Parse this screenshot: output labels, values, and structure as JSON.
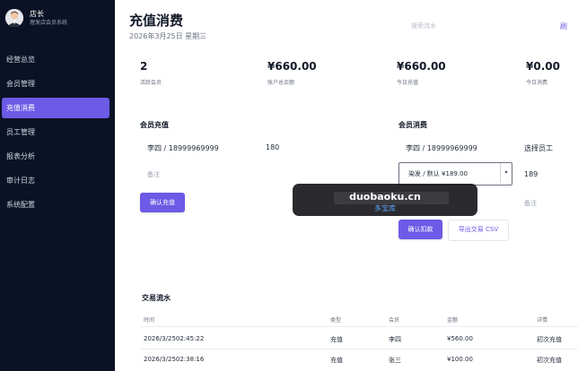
{
  "sidebar": {
    "user": {
      "name": "店长",
      "subtitle": "理发店会员系统"
    },
    "nav": [
      {
        "label": "经营总览"
      },
      {
        "label": "会员管理"
      },
      {
        "label": "充值消费"
      },
      {
        "label": "员工管理"
      },
      {
        "label": "报表分析"
      },
      {
        "label": "审计日志"
      },
      {
        "label": "系统配置"
      }
    ]
  },
  "header": {
    "title": "充值消费",
    "date": "2026年3月25日 星期三",
    "search_placeholder": "搜索流水"
  },
  "stats": [
    {
      "value": "2",
      "label": "活跃会员"
    },
    {
      "value": "¥660.00",
      "label": "账户总余额"
    },
    {
      "value": "¥660.00",
      "label": "今日充值"
    },
    {
      "value": "¥0.00",
      "label": "今日消费"
    }
  ],
  "recharge": {
    "title": "会员充值",
    "member_value": "李四 / 18999969999",
    "amount_value": "180",
    "remark_placeholder": "备注",
    "confirm_label": "确认充值"
  },
  "consume": {
    "title": "会员消费",
    "member_value": "李四 / 18999969999",
    "staff_value": "选择员工",
    "service_value": "染发 / 默认 ¥189.00",
    "price_value": "189",
    "remark_placeholder": "备注",
    "confirm_label": "确认扣款",
    "export_label": "导出交易 CSV"
  },
  "transactions": {
    "title": "交易流水",
    "headers": [
      "时间",
      "类型",
      "会员",
      "金额",
      "详情"
    ],
    "rows": [
      [
        "2026/3/2502:45:22",
        "充值",
        "李四",
        "¥560.00",
        "初次充值"
      ],
      [
        "2026/3/2502:38:16",
        "充值",
        "张三",
        "¥100.00",
        "初次充值"
      ]
    ]
  },
  "overlay": {
    "domain": "duobaoku.cn",
    "name": "多宝库"
  },
  "colors": {
    "sidebar_bg": "#0b1226",
    "accent": "#6d5ae6"
  }
}
